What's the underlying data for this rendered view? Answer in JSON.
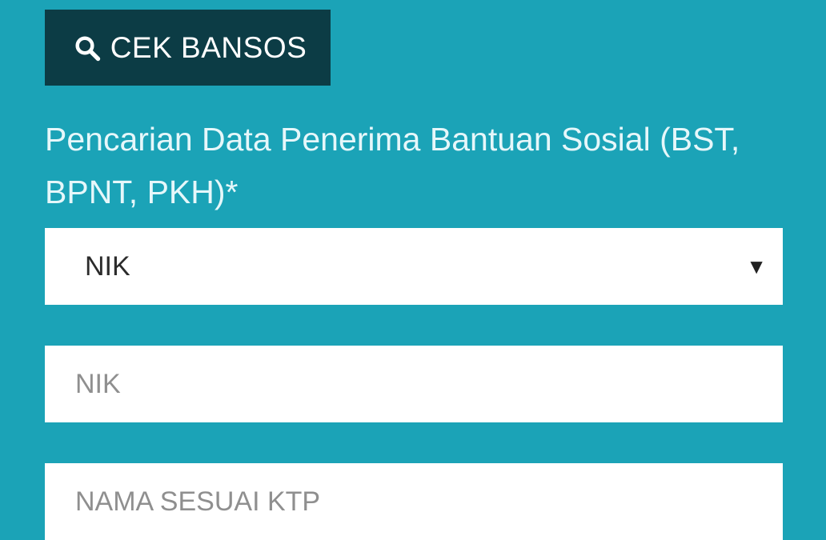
{
  "header": {
    "button_label": "CEK BANSOS",
    "icon": "search-icon"
  },
  "form": {
    "label": "Pencarian Data Penerima Bantuan Sosial (BST, BPNT, PKH)*",
    "select": {
      "selected": "NIK",
      "caret": "▼"
    },
    "inputs": [
      {
        "placeholder": "NIK"
      },
      {
        "placeholder": "NAMA SESUAI KTP"
      }
    ]
  },
  "colors": {
    "background": "#1ba3b7",
    "button": "#0c3c45",
    "field": "#ffffff"
  }
}
